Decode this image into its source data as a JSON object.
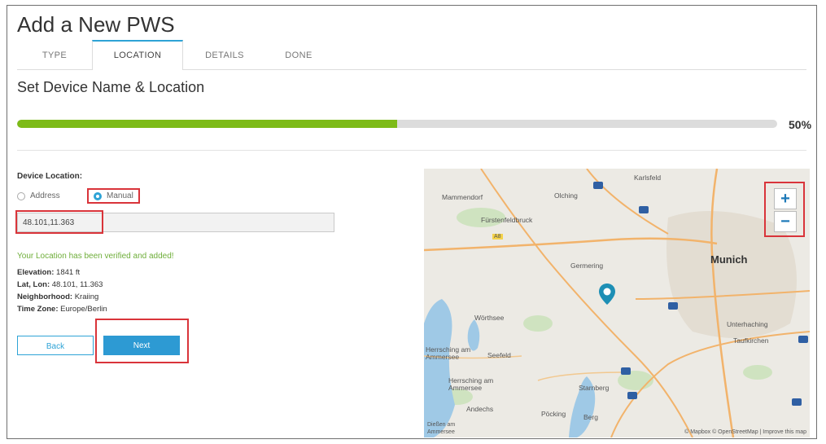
{
  "page": {
    "title": "Add a New PWS"
  },
  "tabs": [
    {
      "label": "TYPE",
      "active": false
    },
    {
      "label": "LOCATION",
      "active": true
    },
    {
      "label": "DETAILS",
      "active": false
    },
    {
      "label": "DONE",
      "active": false
    }
  ],
  "section": {
    "title": "Set Device Name & Location"
  },
  "progress": {
    "value": 0.5,
    "label": "50%"
  },
  "location": {
    "label": "Device Location:",
    "option_address": "Address",
    "option_manual": "Manual",
    "selected": "Manual",
    "coords_value": "48.101,11.363",
    "verified_msg": "Your Location has been verified and added!",
    "elevation_label": "Elevation:",
    "elevation_value": "1841 ft",
    "latlon_label": "Lat, Lon:",
    "latlon_value": "48.101, 11.363",
    "neighborhood_label": "Neighborhood:",
    "neighborhood_value": "Kraiing",
    "timezone_label": "Time Zone:",
    "timezone_value": "Europe/Berlin"
  },
  "buttons": {
    "back": "Back",
    "next": "Next"
  },
  "map": {
    "labels": {
      "karlsfeld": "Karlsfeld",
      "olching": "Olching",
      "mammendorf": "Mammendorf",
      "furstenfeldbruck": "Fürstenfeldbruck",
      "germering": "Germering",
      "munich": "Munich",
      "worthsee": "Wörthsee",
      "unterhaching": "Unterhaching",
      "taufkirchen": "Taufkirchen",
      "herrsching1": "Herrsching am Ammersee",
      "seefeld": "Seefeld",
      "herrsching2": "Herrsching am Ammersee",
      "starnberg": "Starnberg",
      "andechs": "Andechs",
      "pocking": "Pöcking",
      "berg": "Berg",
      "road_a8": "A8",
      "dielsen": "Dießen am Ammersee"
    },
    "zoom_in": "+",
    "zoom_out": "−",
    "attribution": "© Mapbox © OpenStreetMap | Improve this map"
  },
  "colors": {
    "accent": "#2ea3d6",
    "progress": "#7dbb18",
    "highlight": "#d9343a",
    "pin": "#1d8fb5",
    "verified": "#6fae3a"
  }
}
